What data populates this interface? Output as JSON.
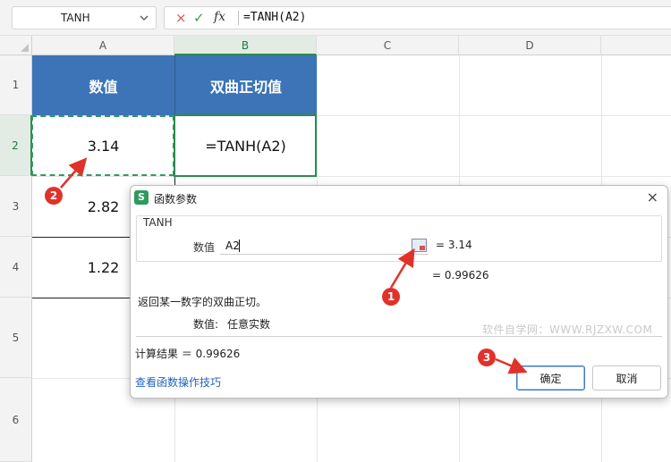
{
  "formula_bar": {
    "name_box": "TANH",
    "formula": "=TANH(A2)",
    "fx_label": "fx",
    "cancel_icon": "×",
    "confirm_icon": "✓"
  },
  "columns": [
    "A",
    "B",
    "C",
    "D"
  ],
  "rows": [
    "1",
    "2",
    "3",
    "4",
    "5",
    "6"
  ],
  "cells": {
    "A1": "数值",
    "B1": "双曲正切值",
    "A2": "3.14",
    "B2": "=TANH(A2)",
    "A3": "2.82",
    "A4": "1.22"
  },
  "dialog": {
    "logo": "S",
    "title": "函数参数",
    "close": "×",
    "function_name": "TANH",
    "arg_label": "数值",
    "arg_value": "A2",
    "arg_result": "=  3.14",
    "function_result": "=  0.99626",
    "description": "返回某一数字的双曲正切。",
    "param_desc_label": "数值:",
    "param_desc_text": "任意实数",
    "watermark": "软件自学网：WWW.RJZXW.COM",
    "calc_result": "计算结果 ＝  0.99626",
    "help_link": "查看函数操作技巧",
    "ok": "确定",
    "cancel": "取消"
  },
  "annotations": [
    "1",
    "2",
    "3"
  ],
  "colors": {
    "header_fill": "#3c74b7",
    "selection_green": "#2e8b4e",
    "annotation_red": "#e0322a"
  }
}
